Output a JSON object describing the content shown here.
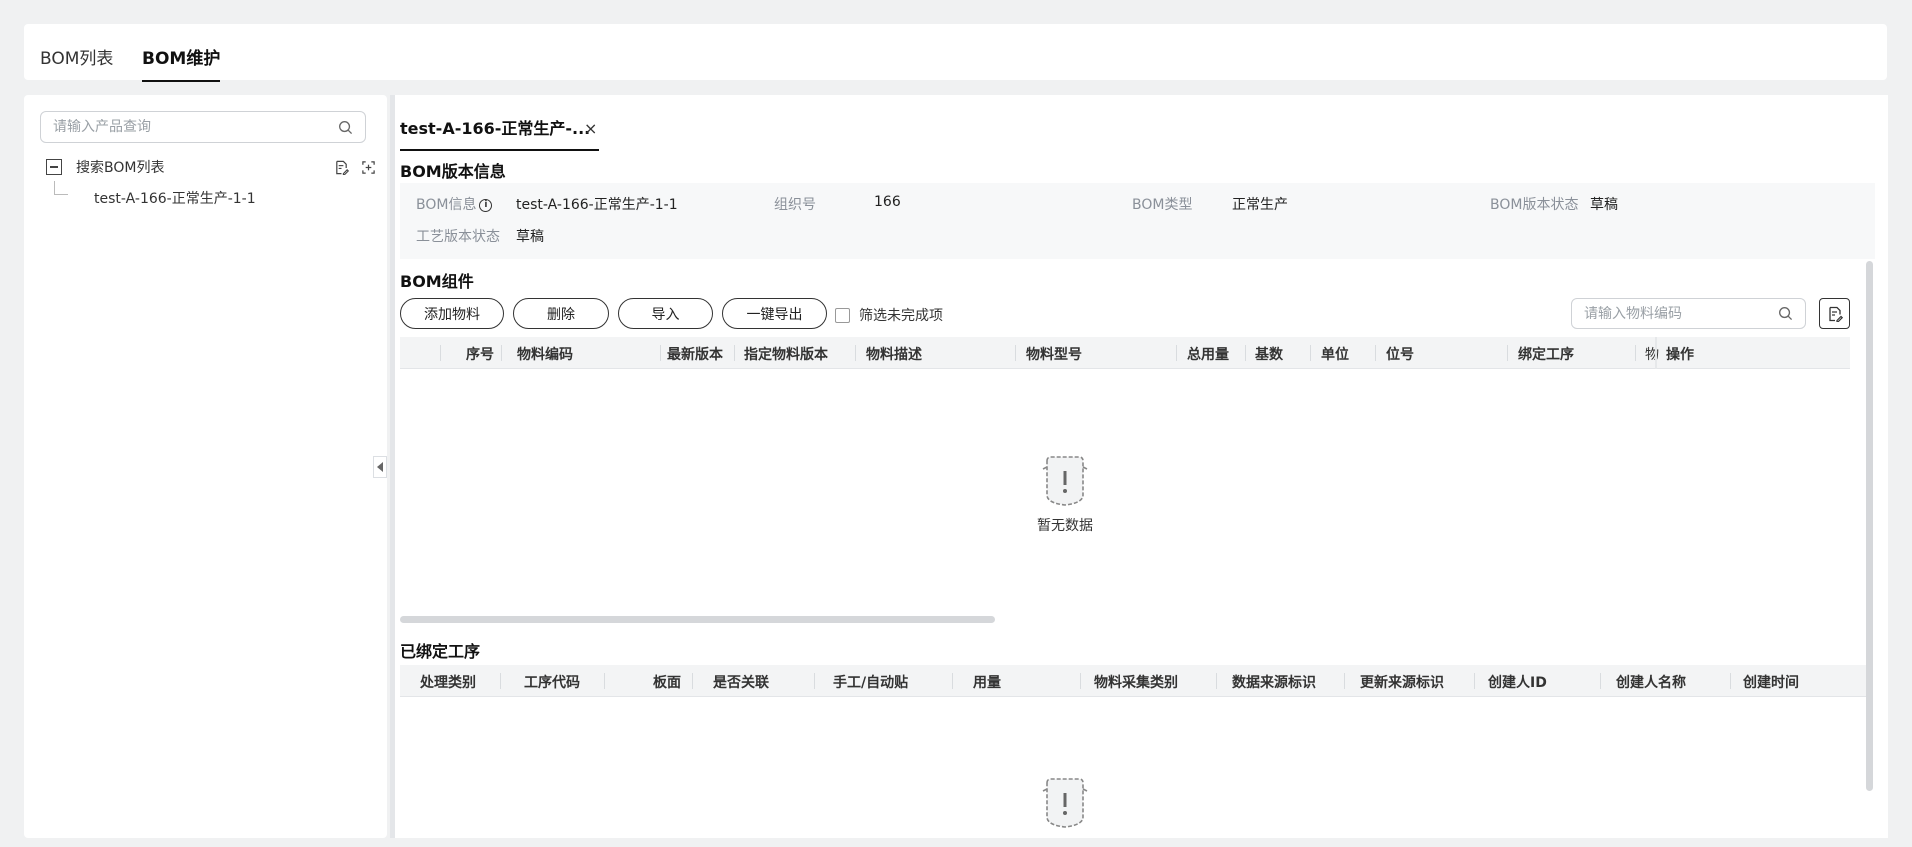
{
  "top_tabs": [
    {
      "label": "BOM列表",
      "active": false
    },
    {
      "label": "BOM维护",
      "active": true
    }
  ],
  "left_panel": {
    "search_placeholder": "请输入产品查询",
    "tree_root_label": "搜索BOM列表",
    "tree_child_label": "test-A-166-正常生产-1-1"
  },
  "doc_tab": {
    "title": "test-A-166-正常生产-...",
    "close": "×"
  },
  "bom_version": {
    "title": "BOM版本信息",
    "fields": [
      {
        "key": "BOM信息",
        "value": "test-A-166-正常生产-1-1"
      },
      {
        "key": "组织号",
        "value": "166"
      },
      {
        "key": "BOM类型",
        "value": "正常生产"
      },
      {
        "key": "BOM版本状态",
        "value": "草稿"
      },
      {
        "key": "工艺版本状态",
        "value": "草稿"
      }
    ]
  },
  "bom_components": {
    "title": "BOM组件",
    "buttons": {
      "add": "添加物料",
      "delete": "删除",
      "import": "导入",
      "export": "一键导出"
    },
    "filter_label": "筛选未完成项",
    "search_placeholder": "请输入物料编码",
    "columns": [
      "序号",
      "物料编码",
      "最新版本",
      "指定物料版本",
      "物料描述",
      "物料型号",
      "总用量",
      "基数",
      "单位",
      "位号",
      "绑定工序",
      "物",
      "操作"
    ],
    "empty_text": "暂无数据"
  },
  "bound_processes": {
    "title": "已绑定工序",
    "columns": [
      "处理类别",
      "工序代码",
      "板面",
      "是否关联",
      "手工/自动贴",
      "用量",
      "物料采集类别",
      "数据来源标识",
      "更新来源标识",
      "创建人ID",
      "创建人名称",
      "创建时间"
    ]
  }
}
